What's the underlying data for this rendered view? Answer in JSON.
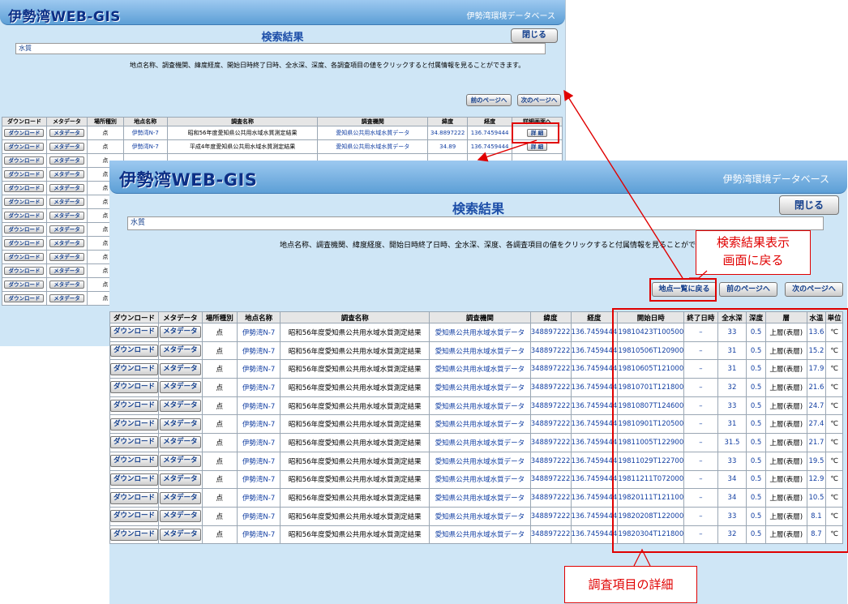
{
  "app": {
    "logo": "伊勢湾WEB-GIS",
    "subtitle": "伊勢湾環境データベース",
    "title": "検索結果",
    "close_label": "閉じる",
    "query": "水質",
    "note": "地点名称、調査機関、緯度経度、開始日時終了日時、全水深、深度、各調査項目の値をクリックすると付属情報を見ることができます。",
    "note_front": "地点名称、調査機関、緯度経度、開始日時終了日時、全水深、深度、各調査項目の値をクリックすると付属情報を見ることができ",
    "nav": {
      "back_to_list": "地点一覧に戻る",
      "prev": "前のページへ",
      "next": "次のページへ"
    }
  },
  "back_table": {
    "headers": [
      "ダウンロード",
      "メタデータ",
      "場所種別",
      "地点名称",
      "調査名称",
      "調査機関",
      "緯度",
      "経度",
      "詳細画面へ"
    ],
    "button_download": "ダウンロード",
    "button_meta": "メタデータ",
    "button_detail": "詳 細",
    "rows": [
      {
        "type": "点",
        "site": "伊勢湾N-7",
        "survey": "昭和56年度愛知県公共用水域水質測定結果",
        "agency": "愛知県公共用水域水質データ",
        "lat": "34.8897222",
        "lon": "136.7459444"
      },
      {
        "type": "点",
        "site": "伊勢湾N-7",
        "survey": "平成4年度愛知県公共用水域水質測定結果",
        "agency": "愛知県公共用水域水質データ",
        "lat": "34.89",
        "lon": "136.7459444"
      }
    ],
    "extra_rows": [
      "点",
      "点",
      "点",
      "点",
      "点",
      "点",
      "点",
      "点",
      "点",
      "点",
      "点"
    ]
  },
  "front_table": {
    "headers": [
      "ダウンロード",
      "メタデータ",
      "場所種別",
      "地点名称",
      "調査名称",
      "調査機関",
      "緯度",
      "経度",
      "開始日時",
      "終了日時",
      "全水深",
      "深度",
      "層",
      "水温",
      "単位"
    ],
    "button_download": "ダウンロード",
    "button_meta": "メタデータ",
    "rows": [
      {
        "type": "点",
        "site": "伊勢湾N-7",
        "survey": "昭和56年度愛知県公共用水域水質測定結果",
        "agency": "愛知県公共用水域水質データ",
        "lat": "348897222",
        "lon": "136.7459444",
        "start": "19810423T100500",
        "end": "–",
        "total_depth": "33",
        "depth": "0.5",
        "layer": "上層(表層)",
        "temp": "13.6",
        "unit": "℃"
      },
      {
        "type": "点",
        "site": "伊勢湾N-7",
        "survey": "昭和56年度愛知県公共用水域水質測定結果",
        "agency": "愛知県公共用水域水質データ",
        "lat": "348897222",
        "lon": "136.7459444",
        "start": "19810506T120900",
        "end": "–",
        "total_depth": "31",
        "depth": "0.5",
        "layer": "上層(表層)",
        "temp": "15.2",
        "unit": "℃"
      },
      {
        "type": "点",
        "site": "伊勢湾N-7",
        "survey": "昭和56年度愛知県公共用水域水質測定結果",
        "agency": "愛知県公共用水域水質データ",
        "lat": "348897222",
        "lon": "136.7459444",
        "start": "19810605T121000",
        "end": "–",
        "total_depth": "31",
        "depth": "0.5",
        "layer": "上層(表層)",
        "temp": "17.9",
        "unit": "℃"
      },
      {
        "type": "点",
        "site": "伊勢湾N-7",
        "survey": "昭和56年度愛知県公共用水域水質測定結果",
        "agency": "愛知県公共用水域水質データ",
        "lat": "348897222",
        "lon": "136.7459444",
        "start": "19810701T121800",
        "end": "–",
        "total_depth": "32",
        "depth": "0.5",
        "layer": "上層(表層)",
        "temp": "21.6",
        "unit": "℃"
      },
      {
        "type": "点",
        "site": "伊勢湾N-7",
        "survey": "昭和56年度愛知県公共用水域水質測定結果",
        "agency": "愛知県公共用水域水質データ",
        "lat": "348897222",
        "lon": "136.7459444",
        "start": "19810807T124600",
        "end": "–",
        "total_depth": "33",
        "depth": "0.5",
        "layer": "上層(表層)",
        "temp": "24.7",
        "unit": "℃"
      },
      {
        "type": "点",
        "site": "伊勢湾N-7",
        "survey": "昭和56年度愛知県公共用水域水質測定結果",
        "agency": "愛知県公共用水域水質データ",
        "lat": "348897222",
        "lon": "136.7459444",
        "start": "19810901T120500",
        "end": "–",
        "total_depth": "31",
        "depth": "0.5",
        "layer": "上層(表層)",
        "temp": "27.4",
        "unit": "℃"
      },
      {
        "type": "点",
        "site": "伊勢湾N-7",
        "survey": "昭和56年度愛知県公共用水域水質測定結果",
        "agency": "愛知県公共用水域水質データ",
        "lat": "348897222",
        "lon": "136.7459444",
        "start": "19811005T122900",
        "end": "–",
        "total_depth": "31.5",
        "depth": "0.5",
        "layer": "上層(表層)",
        "temp": "21.7",
        "unit": "℃"
      },
      {
        "type": "点",
        "site": "伊勢湾N-7",
        "survey": "昭和56年度愛知県公共用水域水質測定結果",
        "agency": "愛知県公共用水域水質データ",
        "lat": "348897222",
        "lon": "136.7459444",
        "start": "19811029T122700",
        "end": "–",
        "total_depth": "33",
        "depth": "0.5",
        "layer": "上層(表層)",
        "temp": "19.5",
        "unit": "℃"
      },
      {
        "type": "点",
        "site": "伊勢湾N-7",
        "survey": "昭和56年度愛知県公共用水域水質測定結果",
        "agency": "愛知県公共用水域水質データ",
        "lat": "348897222",
        "lon": "136.7459444",
        "start": "19811211T072000",
        "end": "–",
        "total_depth": "34",
        "depth": "0.5",
        "layer": "上層(表層)",
        "temp": "12.9",
        "unit": "℃"
      },
      {
        "type": "点",
        "site": "伊勢湾N-7",
        "survey": "昭和56年度愛知県公共用水域水質測定結果",
        "agency": "愛知県公共用水域水質データ",
        "lat": "348897222",
        "lon": "136.7459444",
        "start": "19820111T121100",
        "end": "–",
        "total_depth": "34",
        "depth": "0.5",
        "layer": "上層(表層)",
        "temp": "10.5",
        "unit": "℃"
      },
      {
        "type": "点",
        "site": "伊勢湾N-7",
        "survey": "昭和56年度愛知県公共用水域水質測定結果",
        "agency": "愛知県公共用水域水質データ",
        "lat": "348897222",
        "lon": "136.7459444",
        "start": "19820208T122000",
        "end": "–",
        "total_depth": "33",
        "depth": "0.5",
        "layer": "上層(表層)",
        "temp": "8.1",
        "unit": "℃"
      },
      {
        "type": "点",
        "site": "伊勢湾N-7",
        "survey": "昭和56年度愛知県公共用水域水質測定結果",
        "agency": "愛知県公共用水域水質データ",
        "lat": "348897222",
        "lon": "136.7459444",
        "start": "19820304T121800",
        "end": "–",
        "total_depth": "32",
        "depth": "0.5",
        "layer": "上層(表層)",
        "temp": "8.7",
        "unit": "℃"
      }
    ]
  },
  "annotations": {
    "back_to_results": [
      "検索結果表示",
      "画面に戻る"
    ],
    "detail_items": "調査項目の詳細",
    "accent_color": "#e00000"
  }
}
